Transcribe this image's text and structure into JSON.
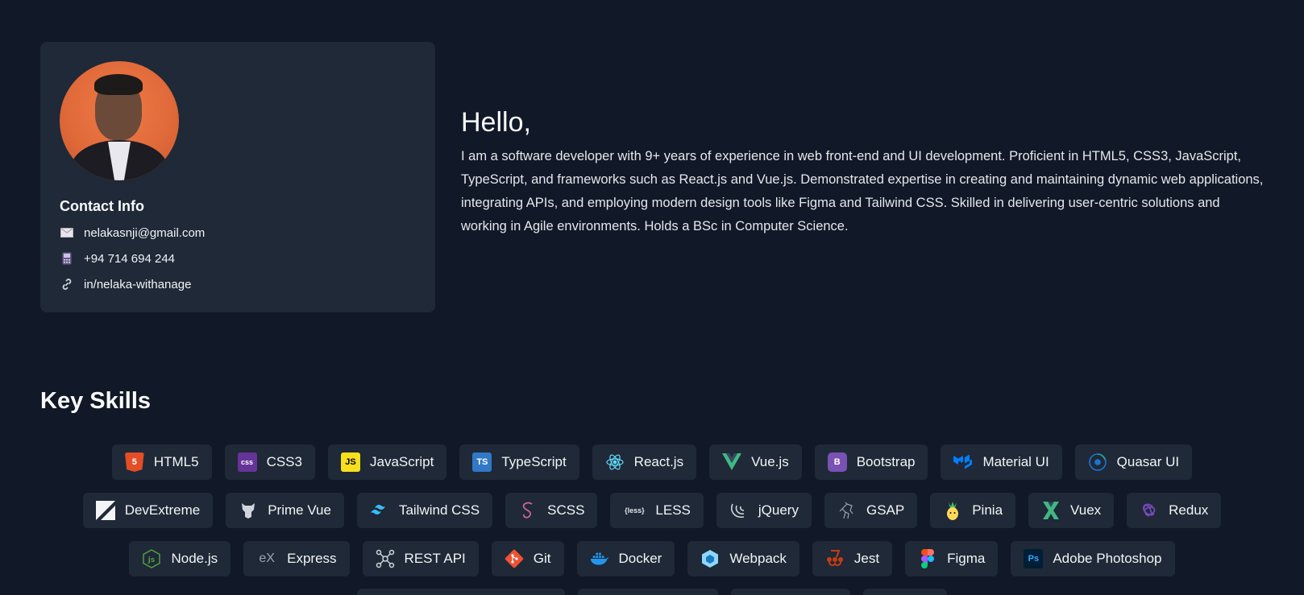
{
  "contact": {
    "title": "Contact Info",
    "email": "nelakasnji@gmail.com",
    "phone": "+94 714 694 244",
    "linkedin": "in/nelaka-withanage"
  },
  "intro": {
    "greeting": "Hello,",
    "bio": "I am a software developer with 9+ years of experience in web front-end and UI development. Proficient in HTML5, CSS3, JavaScript, TypeScript, and frameworks such as React.js and Vue.js. Demonstrated expertise in creating and maintaining dynamic web applications, integrating APIs, and employing modern design tools like Figma and Tailwind CSS. Skilled in delivering user-centric solutions and working in Agile environments. Holds a BSc in Computer Science."
  },
  "skills": {
    "title": "Key Skills",
    "row1": [
      "HTML5",
      "CSS3",
      "JavaScript",
      "TypeScript",
      "React.js",
      "Vue.js",
      "Bootstrap",
      "Material UI",
      "Quasar UI"
    ],
    "row2": [
      "DevExtreme",
      "Prime Vue",
      "Tailwind CSS",
      "SCSS",
      "LESS",
      "jQuery",
      "GSAP",
      "Pinia",
      "Vuex",
      "Redux"
    ],
    "row3": [
      "Node.js",
      "Express",
      "REST API",
      "Git",
      "Docker",
      "Webpack",
      "Jest",
      "Figma",
      "Adobe Photoshop"
    ]
  },
  "colors": {
    "background": "#111827",
    "card": "#1f2937"
  }
}
